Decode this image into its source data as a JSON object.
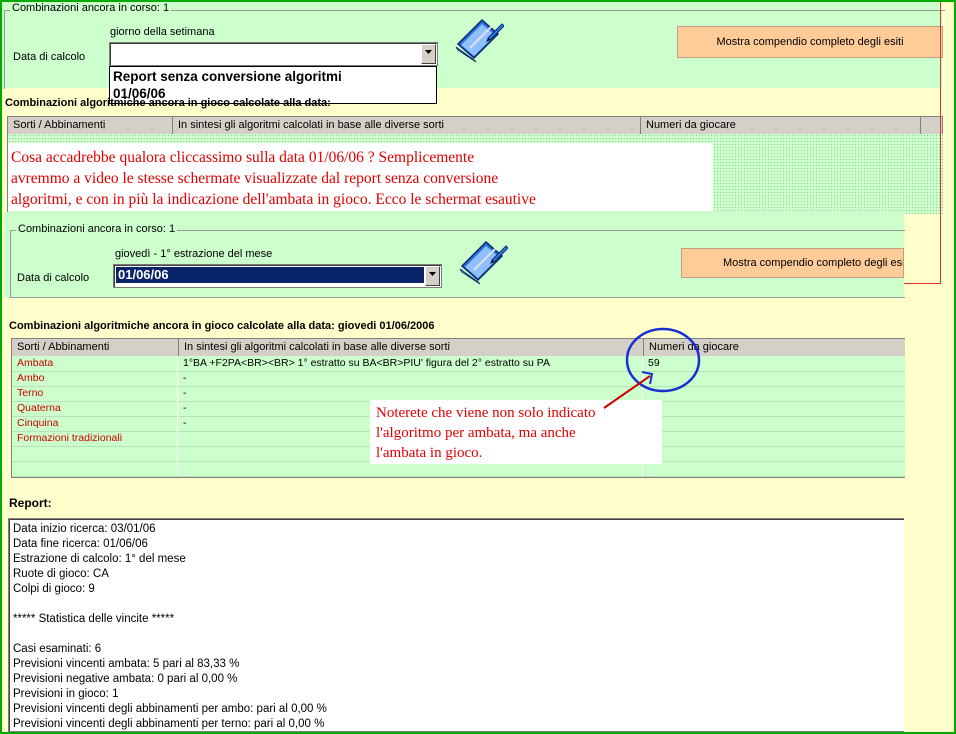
{
  "window_back": {
    "group_title": "Combinazioni ancora in corso: 1",
    "data_di_calcolo_label": "Data di calcolo",
    "giorno_label": "giorno della setimana",
    "dropdown_value": "",
    "dropdown_options": [
      "Report senza conversione algoritmi",
      "01/06/06"
    ],
    "compendio_button": "Mostra compendio completo degli esiti",
    "combinazioni_title": "Combinazioni algoritmiche ancora in gioco calcolate alla data:",
    "columns": [
      "Sorti / Abbinamenti",
      "In sintesi gli algoritmi calcolati in base alle diverse sorti",
      "Numeri da giocare"
    ]
  },
  "annotation_top": {
    "lines": [
      "Cosa accadrebbe qualora cliccassimo sulla data 01/06/06 ? Semplicemente",
      "avremmo a video le stesse schermate visualizzate dal report senza conversione",
      "algoritmi, e con in più la indicazione dell'ambata in gioco. Ecco le schermat esautive"
    ]
  },
  "window_front": {
    "group_title": "Combinazioni ancora in corso: 1",
    "data_di_calcolo_label": "Data di calcolo",
    "giorno_label": "giovedì - 1°  estrazione del mese",
    "dropdown_value": "01/06/06",
    "compendio_button": "Mostra compendio completo degli esiti",
    "combinazioni_title": "Combinazioni algoritmiche ancora in gioco calcolate alla data: giovedi 01/06/2006",
    "columns": [
      "Sorti / Abbinamenti",
      "In sintesi gli algoritmi calcolati in base alle diverse sorti",
      "Numeri da giocare"
    ],
    "rows": [
      {
        "sorte": "Ambata",
        "algoritmo": "1°BA +F2PA<BR><BR> 1° estratto su BA<BR>PIU' figura del 2° estratto su PA",
        "numeri": "59"
      },
      {
        "sorte": "Ambo",
        "algoritmo": "-",
        "numeri": ""
      },
      {
        "sorte": "Terno",
        "algoritmo": "-",
        "numeri": ""
      },
      {
        "sorte": "Quaterna",
        "algoritmo": "-",
        "numeri": ""
      },
      {
        "sorte": "Cinquina",
        "algoritmo": "-",
        "numeri": ""
      },
      {
        "sorte": "Formazioni tradizionali",
        "algoritmo": "",
        "numeri": ""
      }
    ]
  },
  "annotation_side": {
    "lines": [
      "Noterete che viene non solo indicato",
      "l'algoritmo per ambata, ma anche",
      "l'ambata in gioco."
    ]
  },
  "report": {
    "title": "Report:",
    "lines": [
      "Data inizio ricerca: 03/01/06",
      "Data fine ricerca: 01/06/06",
      "Estrazione di calcolo:  1° del mese",
      "Ruote di gioco: CA",
      "Colpi di gioco: 9",
      "",
      "***** Statistica delle vincite *****",
      "",
      "Casi esaminati: 6",
      "Previsioni vincenti ambata: 5 pari al 83,33 %",
      "Previsioni negative ambata: 0 pari al 0,00 %",
      "Previsioni in gioco: 1",
      "Previsioni vincenti degli abbinamenti per ambo:  pari al 0,00 %",
      "Previsioni vincenti degli abbinamenti per terno:  pari al 0,00 %"
    ]
  },
  "colors": {
    "annotation_red": "#e00000",
    "highlight_circle": "#1a2fd0",
    "panel_green": "#ccffcc",
    "page_yellow": "#ffffcc",
    "button_orange": "#ffcc99"
  },
  "icons": [
    "book-pen-icon",
    "dropdown-arrow-icon"
  ]
}
